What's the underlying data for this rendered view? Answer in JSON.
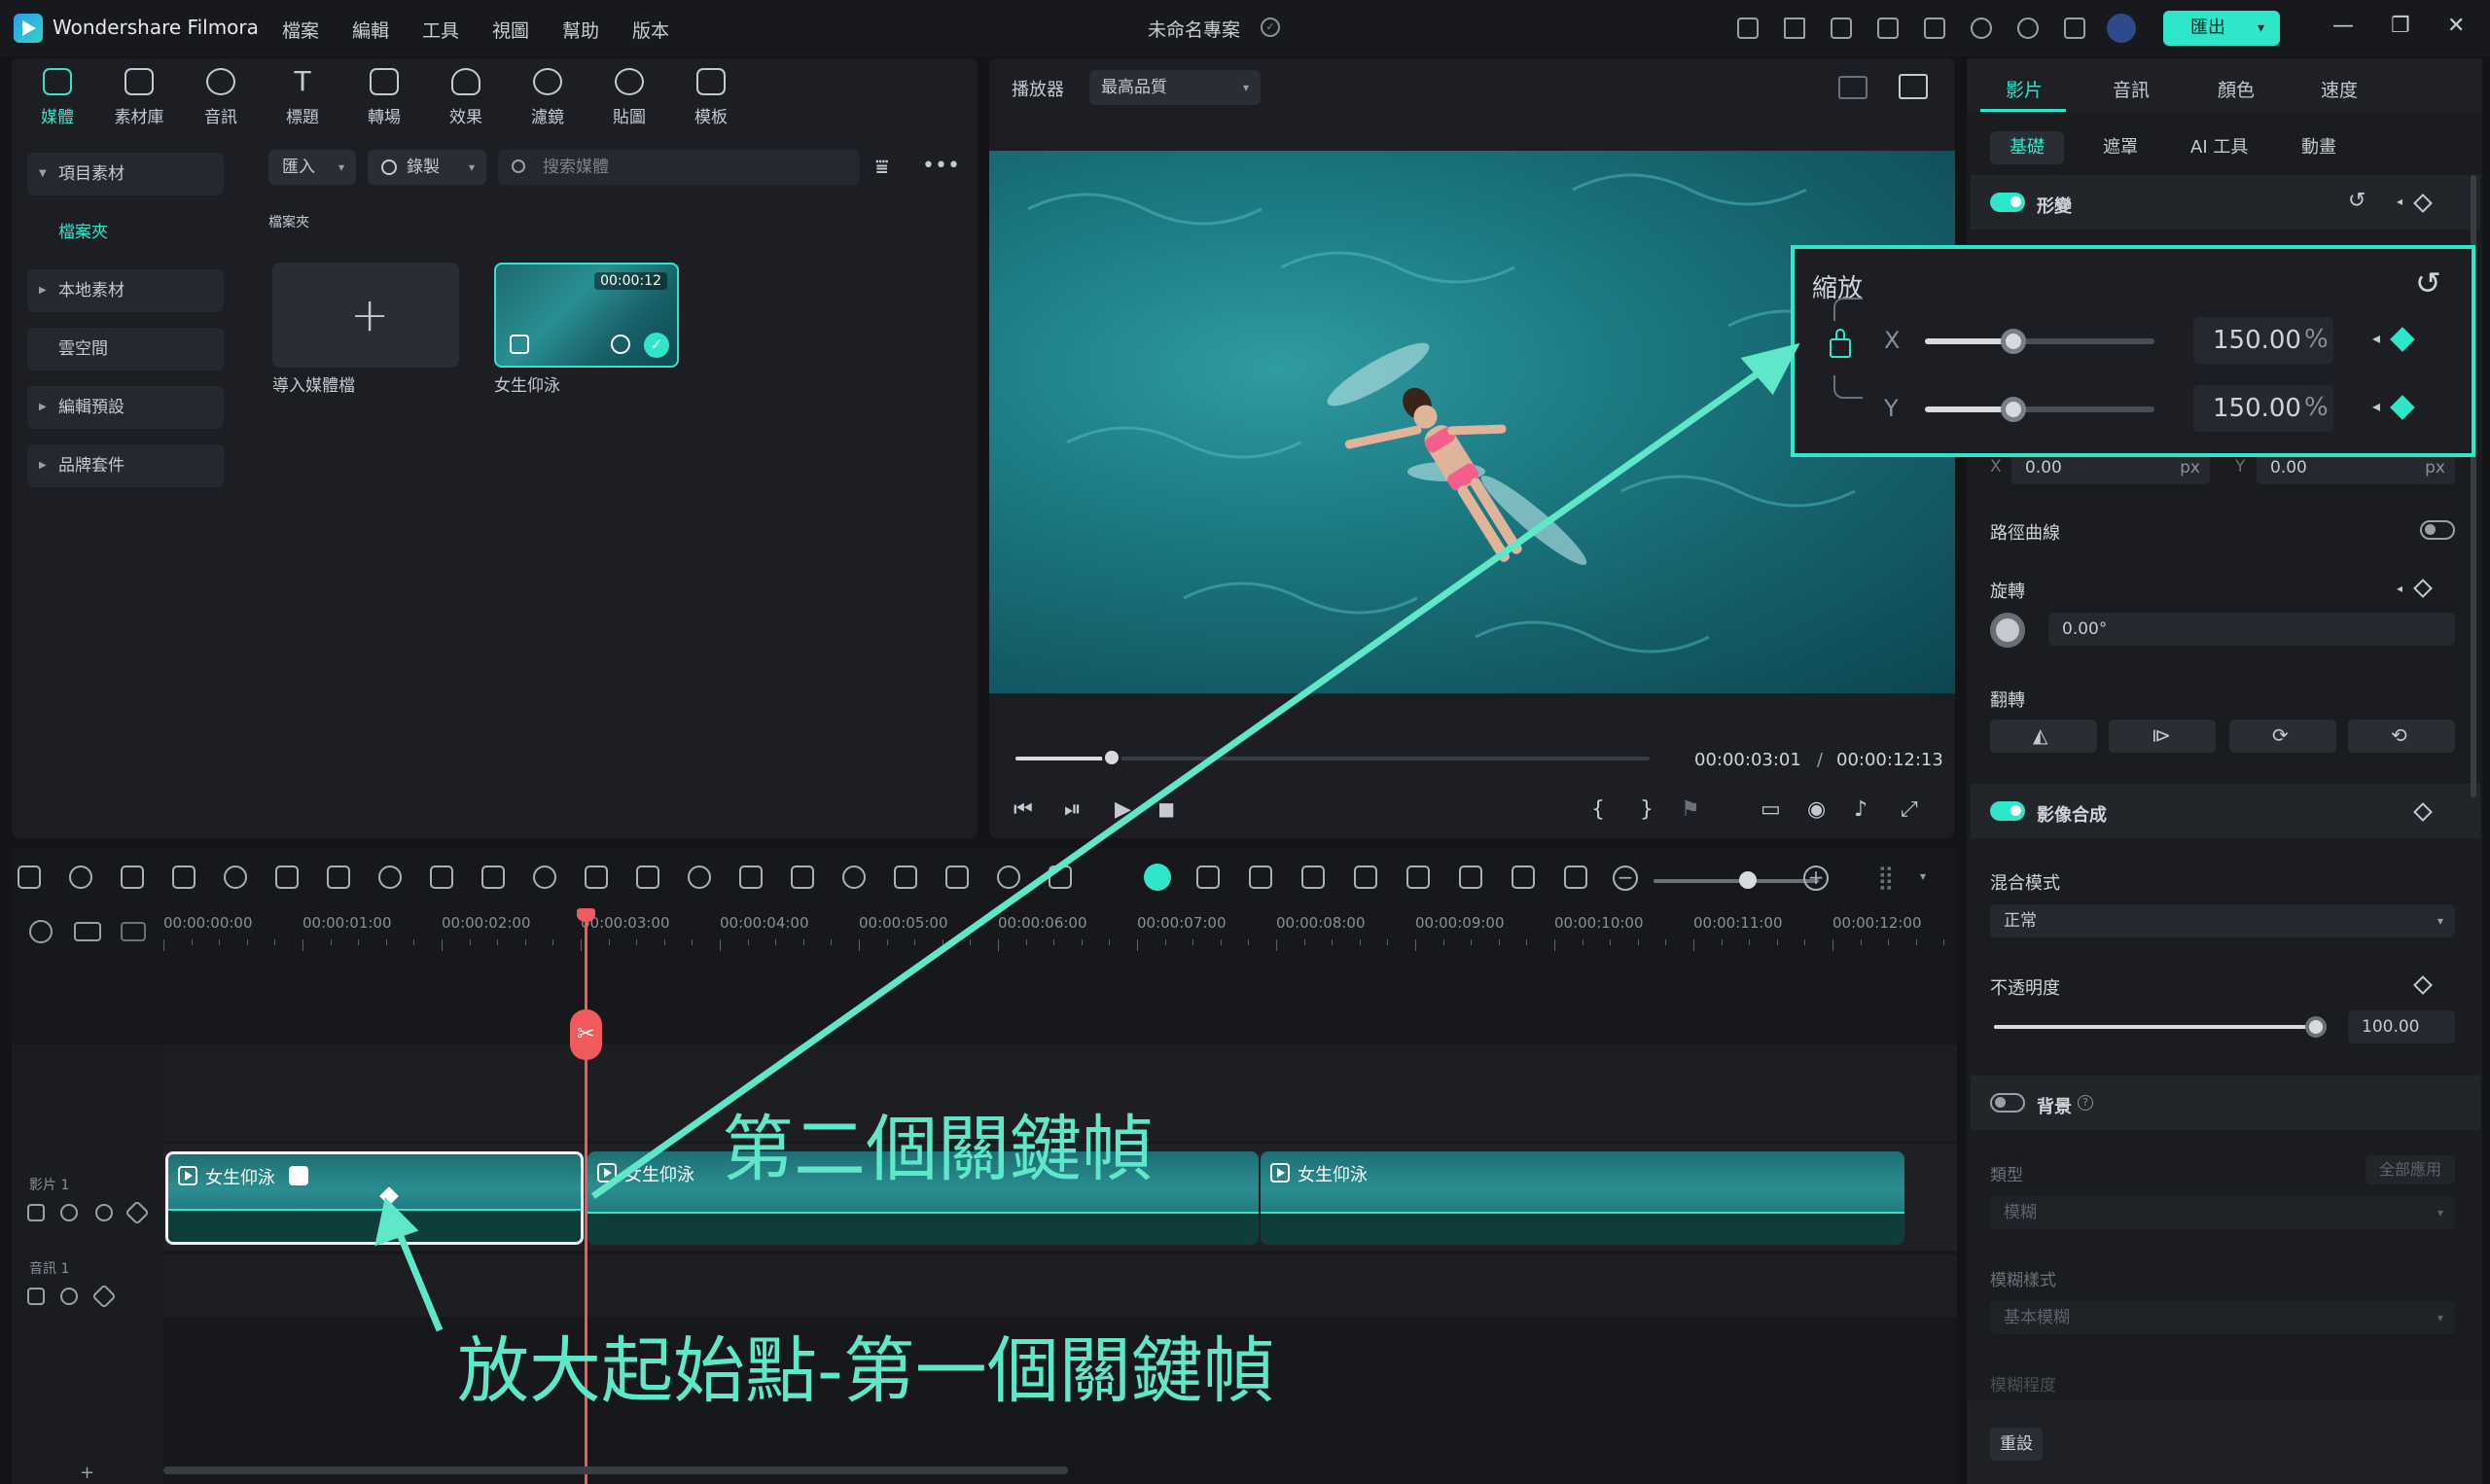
{
  "app": {
    "name": "Wondershare Filmora",
    "project_title": "未命名專案",
    "export_label": "匯出"
  },
  "menu": [
    "檔案",
    "編輯",
    "工具",
    "視圖",
    "幫助",
    "版本"
  ],
  "tool_tabs": [
    "媒體",
    "素材庫",
    "音訊",
    "標題",
    "轉場",
    "效果",
    "濾鏡",
    "貼圖",
    "模板"
  ],
  "sidebar": {
    "items": [
      "項目素材",
      "檔案夾",
      "本地素材",
      "雲空間",
      "編輯預設",
      "品牌套件"
    ]
  },
  "media": {
    "import_label": "匯入",
    "record_label": "錄製",
    "search_placeholder": "搜索媒體",
    "folder_label": "檔案夾",
    "import_card_label": "導入媒體檔",
    "clip": {
      "name": "女生仰泳",
      "duration": "00:00:12"
    }
  },
  "player": {
    "label": "播放器",
    "quality": "最高品質",
    "current_time": "00:00:03:01",
    "separator": "/",
    "total_time": "00:00:12:13",
    "progress_fraction": 0.152
  },
  "props": {
    "tabs": [
      "影片",
      "音訊",
      "顏色",
      "速度"
    ],
    "subtabs": [
      "基礎",
      "遮罩",
      "AI 工具",
      "動畫"
    ],
    "transform": "形變",
    "scale": {
      "title": "縮放",
      "x_label": "X",
      "y_label": "Y",
      "x_value": "150.00",
      "y_value": "150.00",
      "unit": "%"
    },
    "position": {
      "x_label": "X",
      "x_value": "0.00",
      "y_label": "Y",
      "y_value": "0.00",
      "unit": "px"
    },
    "path_curve": "路徑曲線",
    "rotate": "旋轉",
    "rotate_value": "0.00°",
    "flip": "翻轉",
    "composite": "影像合成",
    "blend_mode_label": "混合模式",
    "blend_mode_value": "正常",
    "opacity_label": "不透明度",
    "opacity_value": "100.00",
    "background": "背景",
    "bg_type_label": "類型",
    "apply_all": "全部應用",
    "bg_type_value": "模糊",
    "blur_style_label": "模糊樣式",
    "blur_style_value": "基本模糊",
    "blur_level_label": "模糊程度",
    "reset": "重設"
  },
  "timeline": {
    "ruler": [
      "00:00:00:00",
      "00:00:01:00",
      "00:00:02:00",
      "00:00:03:00",
      "00:00:04:00",
      "00:00:05:00",
      "00:00:06:00",
      "00:00:07:00",
      "00:00:08:00",
      "00:00:09:00",
      "00:00:10:00",
      "00:00:11:00",
      "00:00:12:00"
    ],
    "video_track_label": "影片 1",
    "audio_track_label": "音訊 1",
    "clips": [
      "女生仰泳",
      "女生仰泳",
      "女生仰泳"
    ]
  },
  "annotations": {
    "second_keyframe": "第二個關鍵幀",
    "first_keyframe": "放大起始點-第一個關鍵幀"
  },
  "colors": {
    "accent": "#2ee6c9",
    "annotation": "#5ee8c9",
    "playhead": "#f05a5a"
  }
}
